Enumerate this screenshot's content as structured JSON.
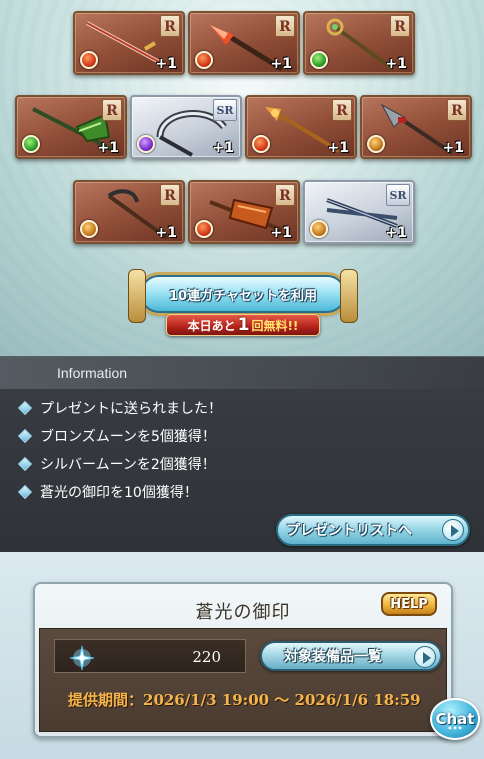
{
  "colors": {
    "card_r_border": "#7a5130",
    "card_sr_border": "#8d98a8",
    "accent_blue": "#4db8d8",
    "free_badge_red": "#b4231b",
    "period_orange": "#f6b44a",
    "help_gold": "#f0b63c"
  },
  "results": {
    "cards": [
      {
        "rarity": "R",
        "plus": "+1",
        "element": "fire",
        "weapon_icon": "sword-icon"
      },
      {
        "rarity": "R",
        "plus": "+1",
        "element": "fire",
        "weapon_icon": "spear-icon"
      },
      {
        "rarity": "R",
        "plus": "+1",
        "element": "wind",
        "weapon_icon": "staff-icon"
      },
      {
        "rarity": "R",
        "plus": "+1",
        "element": "wind",
        "weapon_icon": "axe-icon"
      },
      {
        "rarity": "SR",
        "plus": "+1",
        "element": "dark",
        "weapon_icon": "scythe-icon"
      },
      {
        "rarity": "R",
        "plus": "+1",
        "element": "fire",
        "weapon_icon": "staff-icon"
      },
      {
        "rarity": "R",
        "plus": "+1",
        "element": "earth",
        "weapon_icon": "spear-icon"
      },
      {
        "rarity": "R",
        "plus": "+1",
        "element": "earth",
        "weapon_icon": "scythe-icon"
      },
      {
        "rarity": "R",
        "plus": "+1",
        "element": "fire",
        "weapon_icon": "axe-icon"
      },
      {
        "rarity": "SR",
        "plus": "+1",
        "element": "earth",
        "weapon_icon": "katana-icon"
      }
    ],
    "gacha_button_label": "10連ガチャセットを利用",
    "free_badge": {
      "prefix": "本日あと",
      "count": "1",
      "suffix": "回無料!!"
    }
  },
  "info": {
    "title": "Information",
    "lines": [
      "プレゼントに送られました！",
      "ブロンズムーンを5個獲得！",
      "シルバームーンを2個獲得！",
      "蒼光の御印を10個獲得！"
    ],
    "present_list_button": "プレゼントリストへ"
  },
  "seal": {
    "title": "蒼光の御印",
    "help_label": "HELP",
    "count": "220",
    "equip_list_button": "対象装備品一覧",
    "period": "提供期間：2026/1/3 19:00 〜 2026/1/6 18:59"
  },
  "chat_label": "Chat"
}
